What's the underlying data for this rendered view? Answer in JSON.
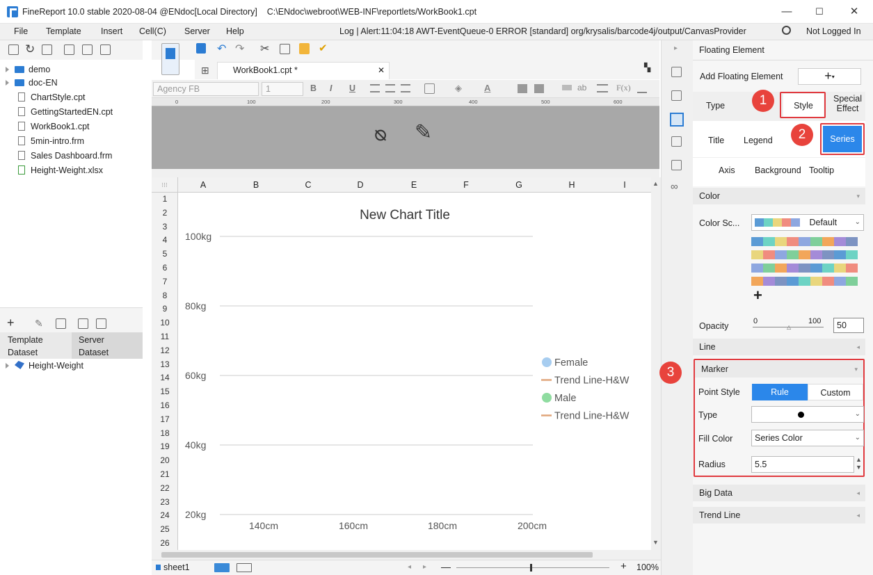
{
  "window": {
    "title": "FineReport 10.0 stable 2020-08-04 @ENdoc[Local Directory]",
    "path": "C:\\ENdoc\\webroot\\WEB-INF\\reportlets/WorkBook1.cpt",
    "minimize": "—",
    "maximize": "☐",
    "close": "✕"
  },
  "menu": {
    "items": [
      "File",
      "Template",
      "Insert",
      "Cell(C)",
      "Server",
      "Help"
    ],
    "log": "Log | Alert:11:04:18 AWT-EventQueue-0 ERROR [standard] org/krysalis/barcode4j/output/CanvasProvider",
    "user": "Not Logged In"
  },
  "tree": {
    "items": [
      "demo",
      "doc-EN",
      "ChartStyle.cpt",
      "GettingStartedEN.cpt",
      "WorkBook1.cpt",
      "5min-intro.frm",
      "Sales Dashboard.frm",
      "Height-Weight.xlsx"
    ]
  },
  "dataset": {
    "tab1a": "Template",
    "tab1b": "Dataset",
    "tab2a": "Server",
    "tab2b": "Dataset",
    "item": "Height-Weight"
  },
  "editor": {
    "tab": "WorkBook1.cpt *",
    "font": "Agency FB",
    "size": "1",
    "fmt": [
      "B",
      "I",
      "U"
    ]
  },
  "ruler": [
    "0",
    "100",
    "200",
    "300",
    "400",
    "500",
    "600"
  ],
  "columns": [
    "A",
    "B",
    "C",
    "D",
    "E",
    "F",
    "G",
    "H",
    "I"
  ],
  "rows": [
    "1",
    "2",
    "3",
    "4",
    "5",
    "6",
    "7",
    "8",
    "9",
    "10",
    "11",
    "12",
    "13",
    "14",
    "15",
    "16",
    "17",
    "18",
    "19",
    "20",
    "21",
    "22",
    "23",
    "24",
    "25",
    "26"
  ],
  "sheet": {
    "name": "sheet1",
    "zoom": "100%"
  },
  "chart_data": {
    "type": "scatter",
    "title": "New Chart Title",
    "y_ticks": [
      "100kg",
      "80kg",
      "60kg",
      "40kg",
      "20kg"
    ],
    "x_ticks": [
      "140cm",
      "160cm",
      "180cm",
      "200cm"
    ],
    "legend": [
      {
        "name": "Female",
        "kind": "point",
        "color": "#a7cdf0"
      },
      {
        "name": "Trend Line-H&W",
        "kind": "line",
        "color": "#e0a57a"
      },
      {
        "name": "Male",
        "kind": "point",
        "color": "#8fdca0"
      },
      {
        "name": "Trend Line-H&W",
        "kind": "line",
        "color": "#e0a57a"
      }
    ]
  },
  "panel": {
    "header": "Floating Element",
    "add_label": "Add Floating Element",
    "tabs_top": [
      "Type",
      "Style",
      "Special",
      "Effect"
    ],
    "tabs_mid": [
      "Title",
      "Legend",
      "Series"
    ],
    "tabs_bot": [
      "Axis",
      "Background",
      "Tooltip"
    ],
    "color_section": "Color",
    "color_scheme_label": "Color Sc...",
    "color_scheme_value": "Default",
    "opacity_label": "Opacity",
    "opacity_min": "0",
    "opacity_max": "100",
    "opacity_value": "50",
    "line_section": "Line",
    "marker_section": "Marker",
    "point_style_label": "Point Style",
    "point_style_rule": "Rule",
    "point_style_custom": "Custom",
    "type_label": "Type",
    "fill_label": "Fill Color",
    "fill_value": "Series Color",
    "radius_label": "Radius",
    "radius_value": "5.5",
    "big_data": "Big Data",
    "trend_line": "Trend Line"
  },
  "badges": [
    "1",
    "2",
    "3"
  ],
  "palette": [
    "#5b9bd5",
    "#6dd3c4",
    "#e9d67d",
    "#f08c7f",
    "#8ea7e0",
    "#7fcf9a",
    "#f2a65a",
    "#a48bd8",
    "#7d93c2"
  ]
}
